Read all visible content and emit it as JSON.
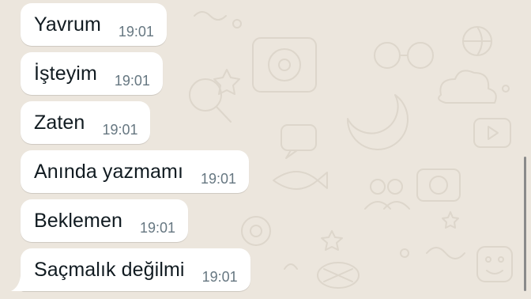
{
  "chat": {
    "wallpaper_color": "#ece6dd",
    "bubble_color": "#ffffff",
    "text_color": "#111b21",
    "time_color": "#667781",
    "messages": [
      {
        "text": "Yavrum",
        "time": "19:01"
      },
      {
        "text": "İşteyim",
        "time": "19:01"
      },
      {
        "text": "Zaten",
        "time": "19:01"
      },
      {
        "text": "Anında yazmamı",
        "time": "19:01"
      },
      {
        "text": "Beklemen",
        "time": "19:01"
      },
      {
        "text": "Saçmalık değilmi",
        "time": "19:01"
      }
    ]
  }
}
